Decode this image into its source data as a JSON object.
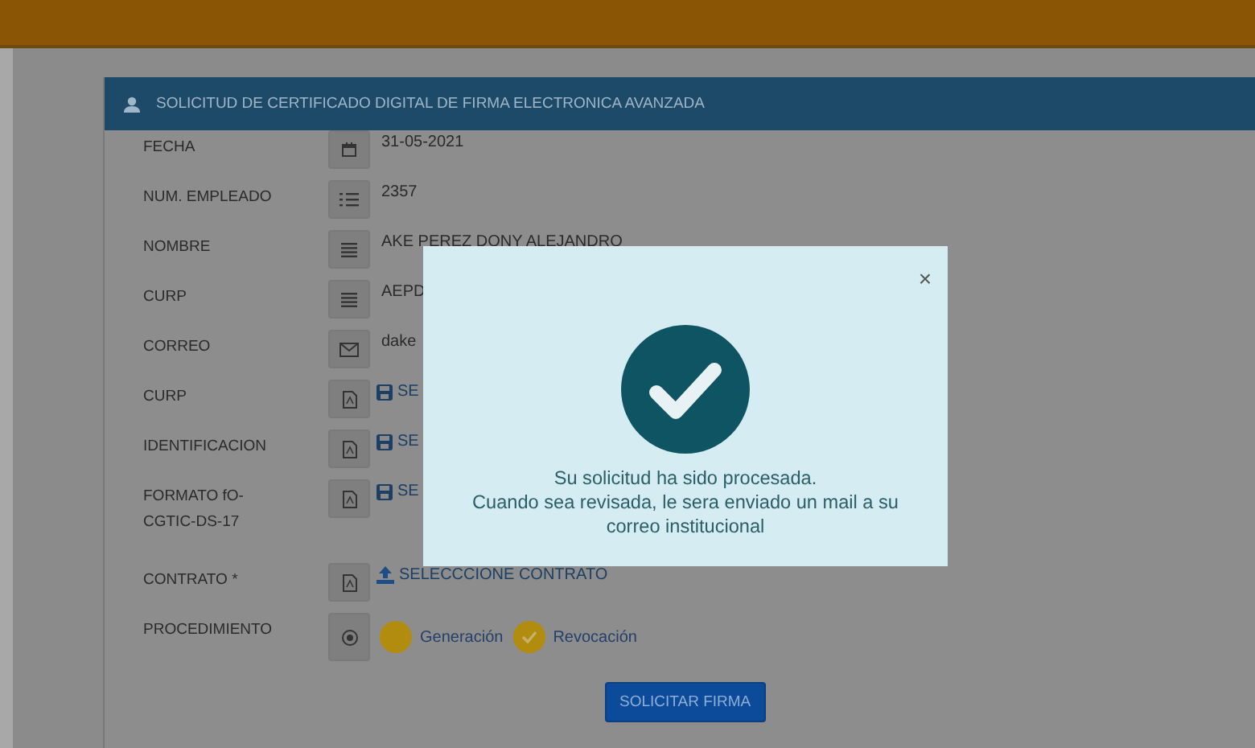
{
  "panel": {
    "title": "SOLICITUD DE CERTIFICADO DIGITAL DE FIRMA ELECTRONICA AVANZADA"
  },
  "fields": [
    {
      "label": "FECHA",
      "kind": "date",
      "value": "31-05-2021"
    },
    {
      "label": "NUM. EMPLEADO",
      "kind": "list",
      "value": "2357"
    },
    {
      "label": "NOMBRE",
      "kind": "text",
      "value": "AKE PEREZ DONY ALEJANDRO"
    },
    {
      "label": "CURP",
      "kind": "text",
      "value": "AEPD"
    },
    {
      "label": "CORREO",
      "kind": "mail",
      "value": "dake"
    },
    {
      "label": "CURP",
      "kind": "file",
      "value": "SE"
    },
    {
      "label": "IDENTIFICACION",
      "kind": "file",
      "value": "SE"
    },
    {
      "label": "FORMATO fO-CGTIC-DS-17",
      "kind": "file",
      "value": "SE"
    },
    {
      "label": "CONTRATO *",
      "kind": "upload",
      "value": "SELECCCIONE CONTRATO"
    }
  ],
  "procedure": {
    "label": "PROCEDIMIENTO",
    "options": [
      {
        "label": "Generación",
        "selected": false
      },
      {
        "label": "Revocación",
        "selected": true
      }
    ]
  },
  "submit": "SOLICITAR FIRMA",
  "modal": {
    "close": "×",
    "message": "Su solicitud ha sido procesada.\nCuando sea revisada, le sera enviado un mail a su correo institucional"
  }
}
